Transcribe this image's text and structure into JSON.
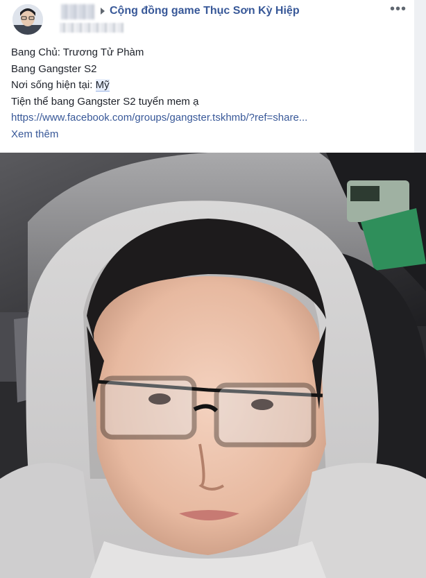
{
  "header": {
    "group_name": "Cộng đồng game Thục Sơn Kỳ Hiệp",
    "more_icon": "more-horizontal-icon",
    "arrow_icon": "triangle-right-icon"
  },
  "post": {
    "lines": {
      "line1": "Bang Chủ: Trương Tử Phàm",
      "line2": "Bang Gangster S2",
      "line3_prefix": "Nơi sống hiện tại: ",
      "line3_highlight": "Mỹ",
      "line4": "Tiện thể bang Gangster S2 tuyển mem ạ"
    },
    "link": "https://www.facebook.com/groups/gangster.tskhmb/?ref=share...",
    "see_more": "Xem thêm"
  },
  "colors": {
    "link": "#385898",
    "text": "#1d2129",
    "meta": "#606770"
  }
}
